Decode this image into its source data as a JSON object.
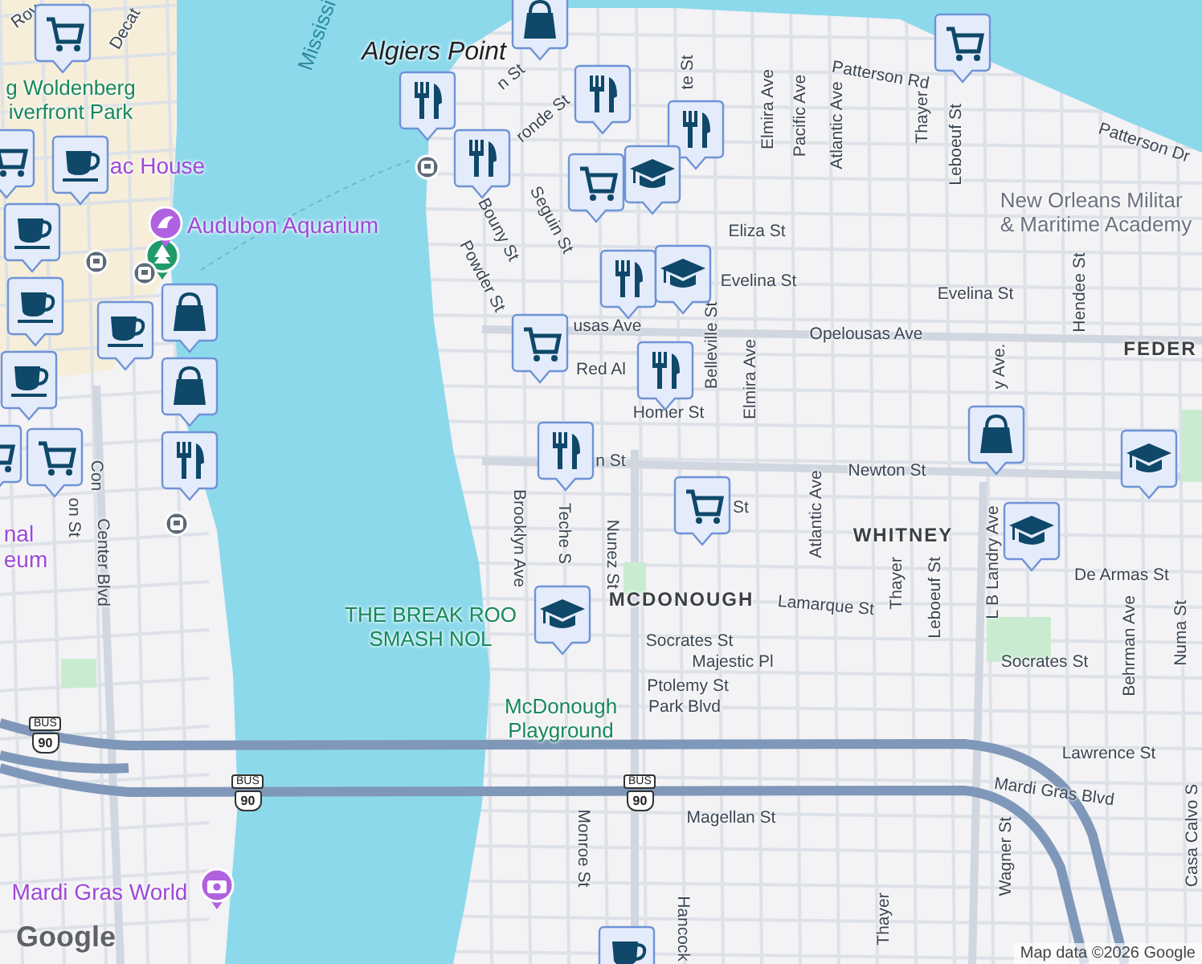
{
  "map": {
    "labels": [
      {
        "text": "Roy",
        "kind": "street"
      },
      {
        "text": "Decat",
        "kind": "street"
      },
      {
        "text": "Mississi",
        "kind": "water"
      },
      {
        "text": "Algiers Point",
        "kind": "locality"
      },
      {
        "text": "n St",
        "kind": "street"
      },
      {
        "text": "ronde St",
        "kind": "street"
      },
      {
        "text": "Bouny St",
        "kind": "street"
      },
      {
        "text": "Seguin St",
        "kind": "street"
      },
      {
        "text": "Powder St",
        "kind": "street"
      },
      {
        "text": "usas Ave",
        "kind": "street"
      },
      {
        "text": "Red Al",
        "kind": "street"
      },
      {
        "text": "te St",
        "kind": "street"
      },
      {
        "text": "Elmira Ave",
        "kind": "street"
      },
      {
        "text": "Pacific Ave",
        "kind": "street"
      },
      {
        "text": "Atlantic Ave",
        "kind": "street"
      },
      {
        "text": "Patterson Rd",
        "kind": "street"
      },
      {
        "text": "Thayer",
        "kind": "street"
      },
      {
        "text": "Leboeuf St",
        "kind": "street"
      },
      {
        "text": "Patterson Dr",
        "kind": "street"
      },
      {
        "text": "Eliza St",
        "kind": "street"
      },
      {
        "text": "New Orleans Militar\n& Maritime Academy",
        "kind": "building"
      },
      {
        "text": "Evelina St",
        "kind": "street"
      },
      {
        "text": "Evelina St",
        "kind": "street"
      },
      {
        "text": "Opelousas Ave",
        "kind": "street"
      },
      {
        "text": "Hendee St",
        "kind": "street"
      },
      {
        "text": "FEDER",
        "kind": "area"
      },
      {
        "text": "Belleville St",
        "kind": "street"
      },
      {
        "text": "Elmira Ave",
        "kind": "street"
      },
      {
        "text": "Homer St",
        "kind": "street"
      },
      {
        "text": "y Ave.",
        "kind": "street"
      },
      {
        "text": "n St",
        "kind": "street"
      },
      {
        "text": "Newton St",
        "kind": "street"
      },
      {
        "text": "St",
        "kind": "street"
      },
      {
        "text": "Brooklyn Ave",
        "kind": "street"
      },
      {
        "text": "Teche S",
        "kind": "street"
      },
      {
        "text": "Nunez St",
        "kind": "street"
      },
      {
        "text": "WHITNEY",
        "kind": "area"
      },
      {
        "text": "Atlantic Ave",
        "kind": "street"
      },
      {
        "text": "Thayer",
        "kind": "street"
      },
      {
        "text": "Leboeuf St",
        "kind": "street"
      },
      {
        "text": "L B Landry Ave",
        "kind": "street"
      },
      {
        "text": "De Armas St",
        "kind": "street"
      },
      {
        "text": "Behrman Ave",
        "kind": "street"
      },
      {
        "text": "Numa St",
        "kind": "street"
      },
      {
        "text": "MCDONOUGH",
        "kind": "area"
      },
      {
        "text": "Lamarque St",
        "kind": "street"
      },
      {
        "text": "Socrates St",
        "kind": "street"
      },
      {
        "text": "Socrates St",
        "kind": "street"
      },
      {
        "text": "Majestic Pl",
        "kind": "street"
      },
      {
        "text": "Ptolemy St",
        "kind": "street"
      },
      {
        "text": "Park Blvd",
        "kind": "street"
      },
      {
        "text": "Lawrence St",
        "kind": "street"
      },
      {
        "text": "Mardi Gras Blvd",
        "kind": "street"
      },
      {
        "text": "Magellan St",
        "kind": "street"
      },
      {
        "text": "Monroe St",
        "kind": "street"
      },
      {
        "text": "Hancock",
        "kind": "street"
      },
      {
        "text": "Wagner St",
        "kind": "street"
      },
      {
        "text": "Thayer",
        "kind": "street"
      },
      {
        "text": "Casa Calvo S",
        "kind": "street"
      },
      {
        "text": "Center Blvd",
        "kind": "street"
      },
      {
        "text": "Con",
        "kind": "street"
      },
      {
        "text": "on St",
        "kind": "street"
      },
      {
        "text": "THE BREAK ROO\nSMASH NOL",
        "kind": "place"
      },
      {
        "text": "McDonough\nPlayground",
        "kind": "place"
      },
      {
        "text": "g Woldenberg\niverfront Park",
        "kind": "place"
      },
      {
        "text": "ac House",
        "kind": "poi"
      },
      {
        "text": "Audubon Aquarium",
        "kind": "poi"
      },
      {
        "text": "nal\neum",
        "kind": "poi"
      },
      {
        "text": "Mardi Gras World",
        "kind": "poi"
      }
    ],
    "pins": [
      {
        "kind": "cart"
      },
      {
        "kind": "bag"
      },
      {
        "kind": "cart"
      },
      {
        "kind": "cup"
      },
      {
        "kind": "cup"
      },
      {
        "kind": "cup"
      },
      {
        "kind": "cup"
      },
      {
        "kind": "bag"
      },
      {
        "kind": "bag"
      },
      {
        "kind": "fork"
      },
      {
        "kind": "cup"
      },
      {
        "kind": "cart"
      },
      {
        "kind": "cart"
      },
      {
        "kind": "fork"
      },
      {
        "kind": "fork"
      },
      {
        "kind": "fork"
      },
      {
        "kind": "fork"
      },
      {
        "kind": "cart"
      },
      {
        "kind": "school"
      },
      {
        "kind": "cart"
      },
      {
        "kind": "fork"
      },
      {
        "kind": "school"
      },
      {
        "kind": "fork"
      },
      {
        "kind": "fork"
      },
      {
        "kind": "cart"
      },
      {
        "kind": "bag"
      },
      {
        "kind": "school"
      },
      {
        "kind": "cart"
      },
      {
        "kind": "school"
      },
      {
        "kind": "school"
      },
      {
        "kind": "cup"
      },
      {
        "kind": "tree"
      },
      {
        "kind": "dolphin"
      },
      {
        "kind": "camera"
      },
      {
        "kind": "ferry"
      },
      {
        "kind": "ferry"
      },
      {
        "kind": "tram"
      },
      {
        "kind": "tram"
      }
    ],
    "route_shields": [
      {
        "top": "BUS",
        "number": "90"
      },
      {
        "top": "BUS",
        "number": "90"
      },
      {
        "top": "BUS",
        "number": "90"
      }
    ],
    "logo": "Google",
    "attribution": "Map data ©2026 Google"
  }
}
